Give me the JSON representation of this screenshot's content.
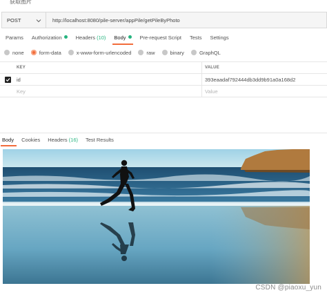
{
  "window": {
    "title": "获取图片"
  },
  "request": {
    "method": "POST",
    "url": "http://localhost:8080/pile-server/appPile/getPileByPhoto"
  },
  "request_tabs": [
    {
      "label": "Params"
    },
    {
      "label": "Authorization"
    },
    {
      "label": "Headers",
      "count": "(10)"
    },
    {
      "label": "Body"
    },
    {
      "label": "Pre-request Script"
    },
    {
      "label": "Tests"
    },
    {
      "label": "Settings"
    }
  ],
  "body_types": [
    {
      "label": "none"
    },
    {
      "label": "form-data",
      "selected": true
    },
    {
      "label": "x-www-form-urlencoded"
    },
    {
      "label": "raw"
    },
    {
      "label": "binary"
    },
    {
      "label": "GraphQL"
    }
  ],
  "params_table": {
    "headers": {
      "key": "KEY",
      "value": "VALUE"
    },
    "rows": [
      {
        "key": "id",
        "value": "393eaadaf792444db3dd9b91a0a168d2",
        "checked": true
      }
    ],
    "placeholder": {
      "key": "Key",
      "value": "Value"
    }
  },
  "response_tabs": [
    {
      "label": "Body"
    },
    {
      "label": "Cookies"
    },
    {
      "label": "Headers",
      "count": "(16)"
    },
    {
      "label": "Test Results"
    }
  ],
  "watermark": "CSDN @piaoxu_yun",
  "colors": {
    "accent": "#f26b3a",
    "indicator_green": "#26b47f"
  }
}
